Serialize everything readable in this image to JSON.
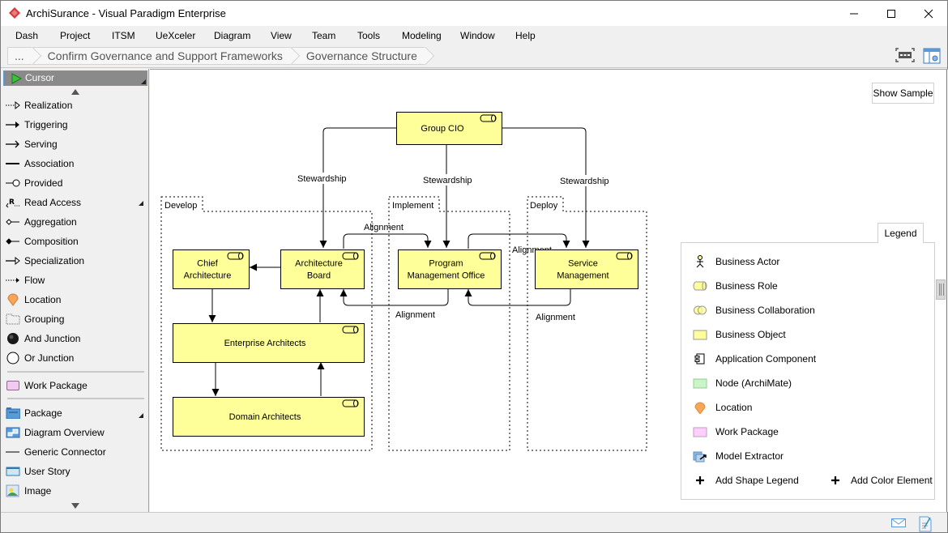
{
  "window": {
    "title": "ArchiSurance - Visual Paradigm Enterprise",
    "controls": [
      "minimize",
      "maximize",
      "close"
    ]
  },
  "menubar": {
    "items": [
      "Dash",
      "Project",
      "ITSM",
      "UeXceler",
      "Diagram",
      "View",
      "Team",
      "Tools",
      "Modeling",
      "Window",
      "Help"
    ]
  },
  "breadcrumb": {
    "items": [
      "...",
      "Confirm Governance and Support Frameworks",
      "Governance Structure"
    ]
  },
  "palette": {
    "selected": "Cursor",
    "items": [
      {
        "label": "Realization",
        "icon": "realization-icon"
      },
      {
        "label": "Triggering",
        "icon": "triggering-icon"
      },
      {
        "label": "Serving",
        "icon": "serving-icon"
      },
      {
        "label": "Association",
        "icon": "association-icon"
      },
      {
        "label": "Provided",
        "icon": "provided-icon"
      },
      {
        "label": "Read Access",
        "icon": "read-access-icon"
      },
      {
        "label": "Aggregation",
        "icon": "aggregation-icon"
      },
      {
        "label": "Composition",
        "icon": "composition-icon"
      },
      {
        "label": "Specialization",
        "icon": "specialization-icon"
      },
      {
        "label": "Flow",
        "icon": "flow-icon"
      },
      {
        "label": "Location",
        "icon": "location-icon"
      },
      {
        "label": "Grouping",
        "icon": "grouping-icon"
      },
      {
        "label": "And Junction",
        "icon": "and-junction-icon"
      },
      {
        "label": "Or Junction",
        "icon": "or-junction-icon"
      },
      {
        "label": "Work Package",
        "icon": "work-package-icon"
      },
      {
        "label": "Package",
        "icon": "package-icon"
      },
      {
        "label": "Diagram Overview",
        "icon": "diagram-overview-icon"
      },
      {
        "label": "Generic Connector",
        "icon": "generic-connector-icon"
      },
      {
        "label": "User Story",
        "icon": "user-story-icon"
      },
      {
        "label": "Image",
        "icon": "image-icon"
      }
    ]
  },
  "canvas": {
    "show_sample_label": "Show Sample"
  },
  "diagram": {
    "groups": [
      {
        "id": "develop",
        "label": "Develop"
      },
      {
        "id": "implement",
        "label": "Implement"
      },
      {
        "id": "deploy",
        "label": "Deploy"
      }
    ],
    "nodes": [
      {
        "id": "group-cio",
        "label": [
          "Group CIO"
        ],
        "type": "Business Role"
      },
      {
        "id": "chief-architecture",
        "label": [
          "Chief",
          "Architecture"
        ],
        "type": "Business Role"
      },
      {
        "id": "architecture-board",
        "label": [
          "Architecture",
          "Board"
        ],
        "type": "Business Role"
      },
      {
        "id": "program-management-office",
        "label": [
          "Program",
          "Management Office"
        ],
        "type": "Business Role"
      },
      {
        "id": "service-management",
        "label": [
          "Service",
          "Management"
        ],
        "type": "Business Role"
      },
      {
        "id": "enterprise-architects",
        "label": [
          "Enterprise Architects"
        ],
        "type": "Business Role"
      },
      {
        "id": "domain-architects",
        "label": [
          "Domain Architects"
        ],
        "type": "Business Role"
      }
    ],
    "edges": [
      {
        "from": "group-cio",
        "to": "architecture-board",
        "label": "Stewardship"
      },
      {
        "from": "group-cio",
        "to": "program-management-office",
        "label": "Stewardship"
      },
      {
        "from": "group-cio",
        "to": "service-management",
        "label": "Stewardship"
      },
      {
        "from": "architecture-board",
        "to": "program-management-office",
        "label": "Alignment"
      },
      {
        "from": "program-management-office",
        "to": "architecture-board",
        "label": "Alignment"
      },
      {
        "from": "program-management-office",
        "to": "service-management",
        "label": "Alignment"
      },
      {
        "from": "service-management",
        "to": "program-management-office",
        "label": "Alignment"
      },
      {
        "from": "architecture-board",
        "to": "chief-architecture",
        "label": ""
      },
      {
        "from": "chief-architecture",
        "to": "enterprise-architects",
        "label": ""
      },
      {
        "from": "enterprise-architects",
        "to": "architecture-board",
        "label": ""
      },
      {
        "from": "enterprise-architects",
        "to": "domain-architects",
        "label": ""
      },
      {
        "from": "domain-architects",
        "to": "enterprise-architects",
        "label": ""
      }
    ],
    "node_fill": "#ffff99",
    "node_stroke": "#000000"
  },
  "legend": {
    "tab_label": "Legend",
    "items": [
      {
        "label": "Business Actor",
        "icon": "business-actor-icon"
      },
      {
        "label": "Business Role",
        "icon": "business-role-icon"
      },
      {
        "label": "Business Collaboration",
        "icon": "business-collaboration-icon"
      },
      {
        "label": "Business Object",
        "icon": "business-object-icon"
      },
      {
        "label": "Application Component",
        "icon": "application-component-icon"
      },
      {
        "label": "Node (ArchiMate)",
        "icon": "node-icon"
      },
      {
        "label": "Location",
        "icon": "location-icon"
      },
      {
        "label": "Work Package",
        "icon": "work-package-icon"
      },
      {
        "label": "Model Extractor",
        "icon": "model-extractor-icon"
      }
    ],
    "add_shape_label": "Add Shape Legend",
    "add_color_label": "Add Color Element"
  },
  "statusbar": {
    "icons": [
      "mail-icon",
      "edit-document-icon"
    ]
  }
}
